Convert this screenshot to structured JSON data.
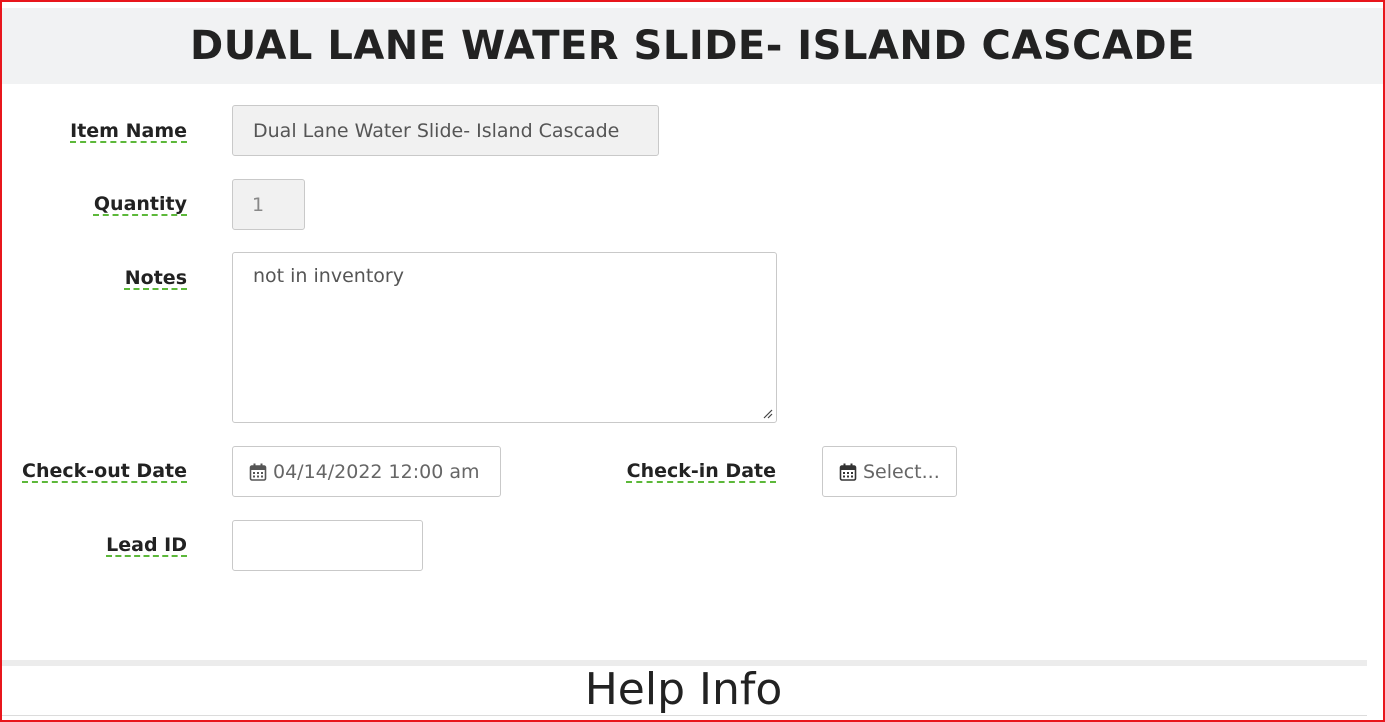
{
  "page": {
    "title": "DUAL LANE WATER SLIDE- ISLAND CASCADE",
    "help_title": "Help Info"
  },
  "form": {
    "item_name": {
      "label": "Item Name",
      "value": "Dual Lane Water Slide- Island Cascade"
    },
    "quantity": {
      "label": "Quantity",
      "value": "1"
    },
    "notes": {
      "label": "Notes",
      "value": "not in inventory"
    },
    "checkout_date": {
      "label": "Check-out Date",
      "value": "04/14/2022 12:00 am"
    },
    "checkin_date": {
      "label": "Check-in Date",
      "value": "Select..."
    },
    "lead_id": {
      "label": "Lead ID",
      "value": ""
    }
  },
  "colors": {
    "frame_border": "#e8161c",
    "label_underline": "#5cb83a",
    "header_bg": "#f1f2f3"
  },
  "icons": [
    "calendar-icon",
    "resize-handle-icon"
  ]
}
